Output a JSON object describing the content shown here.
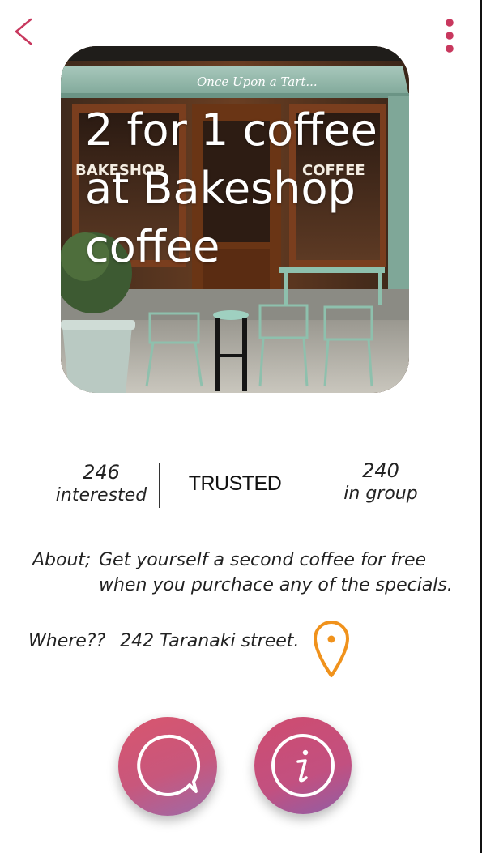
{
  "header": {
    "back_icon": "chevron-left-icon",
    "menu_icon": "more-vertical-icon"
  },
  "hero": {
    "title": "2 for 1 coffee at Bakeshop coffee",
    "image_signs": {
      "awning": "Once Upon a Tart...",
      "left_window": "BAKESHOP",
      "right_window": "COFFEE"
    }
  },
  "stats": {
    "interested_count": "246",
    "interested_label": "interested",
    "trust_label": "TRUSTED",
    "group_count": "240",
    "group_label": "in group"
  },
  "about": {
    "label": "About;",
    "text": "Get yourself a second coffee for free when you purchace any of the specials."
  },
  "where": {
    "label": "Where??",
    "address": "242 Taranaki street."
  },
  "actions": {
    "chat_icon": "chat-bubble-icon",
    "info_icon": "info-icon"
  },
  "colors": {
    "accent": "#c8385e",
    "pin": "#f0921c",
    "button_gradient_start": "#d8556e",
    "button_gradient_end": "#9d6aa8"
  }
}
